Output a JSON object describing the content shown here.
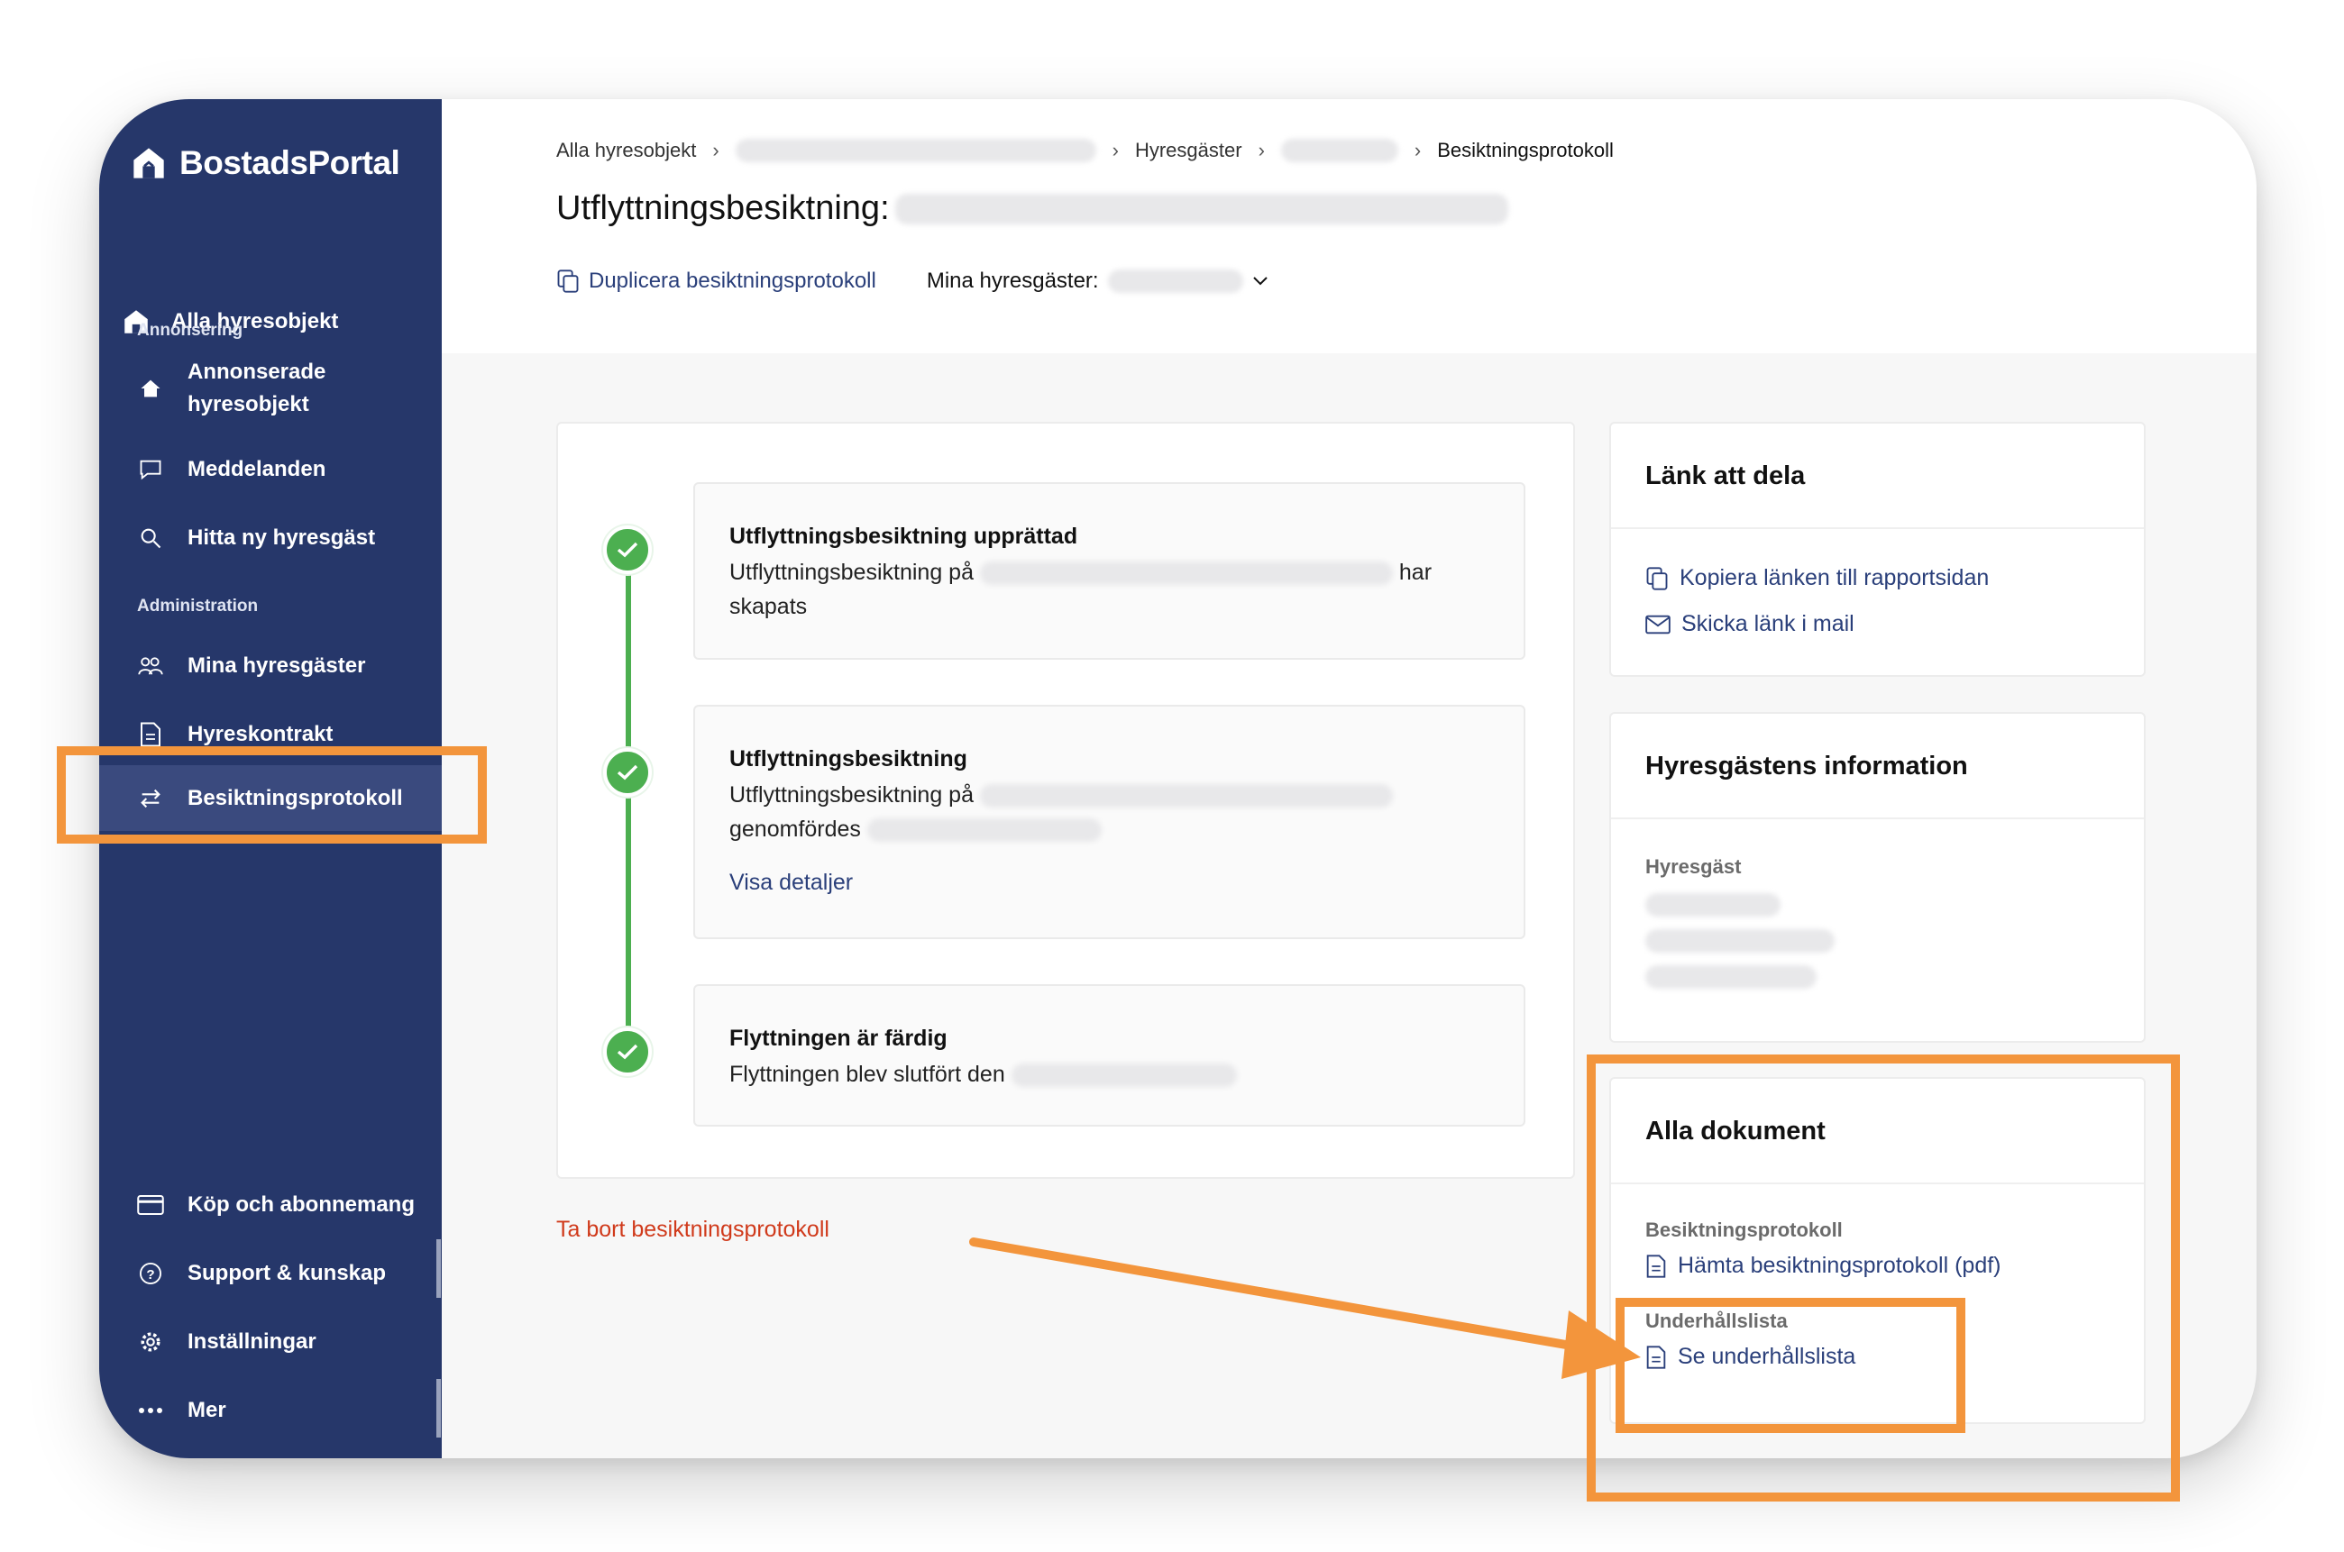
{
  "brand": {
    "name": "BostadsPortal"
  },
  "sidebar": {
    "top_item": "Alla hyresobjekt",
    "section_annonsering": "Annonsering",
    "annonserade_line1": "Annonserade",
    "annonserade_line2": "hyresobjekt",
    "meddelanden": "Meddelanden",
    "hitta": "Hitta ny hyresgäst",
    "section_administration": "Administration",
    "mina_hyresgaster": "Mina hyresgäster",
    "hyreskontrakt": "Hyreskontrakt",
    "besiktningsprotokoll": "Besiktningsprotokoll",
    "kop": "Köp och abonnemang",
    "support": "Support & kunskap",
    "installningar": "Inställningar",
    "mer": "Mer"
  },
  "breadcrumb": {
    "item1": "Alla hyresobjekt",
    "item3": "Hyresgäster",
    "current": "Besiktningsprotokoll"
  },
  "page": {
    "title": "Utflyttningsbesiktning:",
    "duplicate": "Duplicera besiktningsprotokoll",
    "tenants_label": "Mina hyresgäster:"
  },
  "timeline": {
    "step1_title": "Utflyttningsbesiktning upprättad",
    "step1_text_a": "Utflyttningsbesiktning på",
    "step1_text_b": "har",
    "step1_text_c": "skapats",
    "step2_title": "Utflyttningsbesiktning",
    "step2_text_a": "Utflyttningsbesiktning på",
    "step2_text_b": "genomfördes",
    "step2_link": "Visa detaljer",
    "step3_title": "Flyttningen är färdig",
    "step3_text": "Flyttningen blev slutfört den"
  },
  "delete_link": "Ta bort besiktningsprotokoll",
  "share_card": {
    "title": "Länk att dela",
    "copy": "Kopiera länken till rapportsidan",
    "mail": "Skicka länk i mail"
  },
  "tenant_card": {
    "title": "Hyresgästens information",
    "label": "Hyresgäst"
  },
  "docs_card": {
    "title": "Alla dokument",
    "label_protocol": "Besiktningsprotokoll",
    "download": "Hämta besiktningsprotokoll (pdf)",
    "label_maintenance": "Underhållslista",
    "see_maintenance": "Se underhållslista"
  },
  "colors": {
    "sidebar": "#26376a",
    "accent_link": "#2a3f7a",
    "success": "#4caf50",
    "danger": "#d03a1b",
    "annotation": "#f3953c"
  }
}
